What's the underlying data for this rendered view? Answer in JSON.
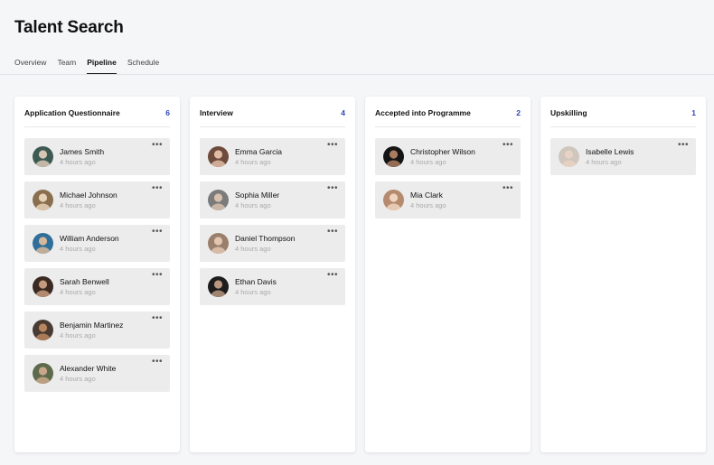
{
  "page": {
    "title": "Talent Search"
  },
  "tabs": [
    {
      "label": "Overview",
      "active": false
    },
    {
      "label": "Team",
      "active": false
    },
    {
      "label": "Pipeline",
      "active": true
    },
    {
      "label": "Schedule",
      "active": false
    }
  ],
  "columns": [
    {
      "title": "Application Questionnaire",
      "count": "6",
      "cards": [
        {
          "name": "James Smith",
          "time": "4 hours ago",
          "avatar": "avatar-photo"
        },
        {
          "name": "Michael Johnson",
          "time": "4 hours ago",
          "avatar": "avatar-photo"
        },
        {
          "name": "William Anderson",
          "time": "4 hours ago",
          "avatar": "avatar-photo"
        },
        {
          "name": "Sarah Benwell",
          "time": "4 hours ago",
          "avatar": "avatar-photo"
        },
        {
          "name": "Benjamin Martinez",
          "time": "4 hours ago",
          "avatar": "avatar-photo"
        },
        {
          "name": "Alexander White",
          "time": "4 hours ago",
          "avatar": "avatar-photo"
        }
      ]
    },
    {
      "title": "Interview",
      "count": "4",
      "cards": [
        {
          "name": "Emma Garcia",
          "time": "4 hours ago",
          "avatar": "avatar-photo"
        },
        {
          "name": "Sophia Miller",
          "time": "4 hours ago",
          "avatar": "avatar-photo"
        },
        {
          "name": "Daniel Thompson",
          "time": "4 hours ago",
          "avatar": "avatar-photo"
        },
        {
          "name": "Ethan Davis",
          "time": "4 hours ago",
          "avatar": "avatar-photo"
        }
      ]
    },
    {
      "title": "Accepted into Programme",
      "count": "2",
      "cards": [
        {
          "name": "Christopher Wilson",
          "time": "4 hours ago",
          "avatar": "avatar-photo"
        },
        {
          "name": "Mia Clark",
          "time": "4 hours ago",
          "avatar": "avatar-photo"
        }
      ]
    },
    {
      "title": "Upskilling",
      "count": "1",
      "cards": [
        {
          "name": "Isabelle Lewis",
          "time": "4 hours ago",
          "avatar": "avatar-photo"
        }
      ]
    }
  ],
  "card_menu_glyph": "•••",
  "colors": {
    "count_accent": "#2c46b8",
    "card_bg": "#ececec",
    "page_bg": "#f5f6f8"
  }
}
